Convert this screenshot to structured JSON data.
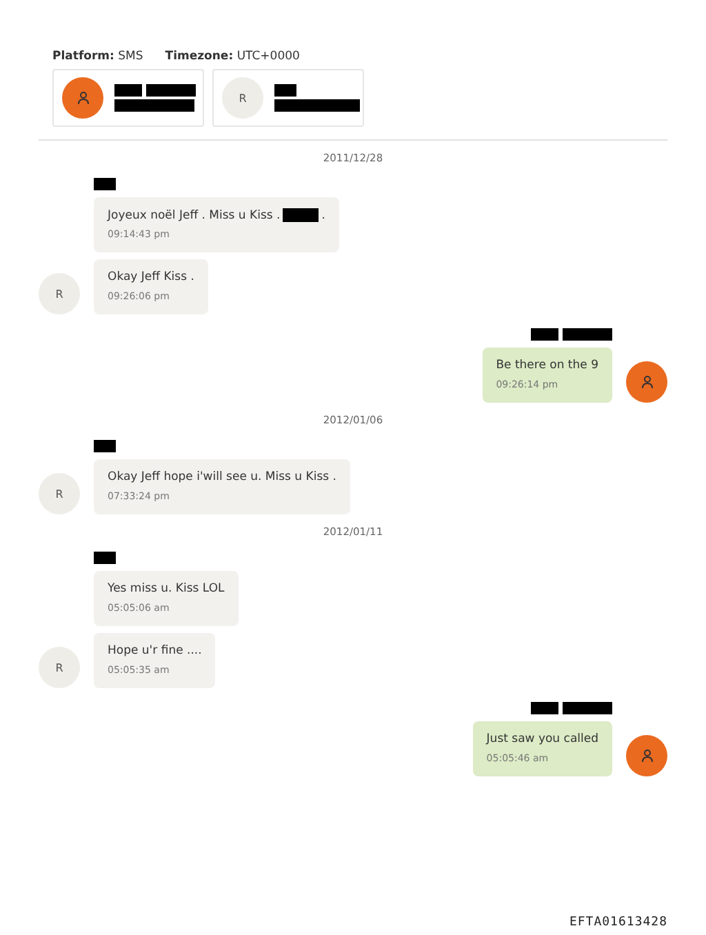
{
  "header": {
    "platform_label": "Platform:",
    "platform": "SMS",
    "timezone_label": "Timezone:",
    "timezone": "UTC+0000"
  },
  "participants": [
    {
      "avatar": {
        "kind": "person"
      }
    },
    {
      "avatar": {
        "kind": "initial",
        "initial": "R"
      }
    }
  ],
  "timeline": [
    {
      "kind": "date",
      "text": "2011/12/28"
    },
    {
      "kind": "group",
      "outgoing": false,
      "avatar": {
        "kind": "initial",
        "initial": "R"
      },
      "messages": [
        {
          "text": "Joyeux noël Jeff . Miss u Kiss .",
          "redacted_tail": true,
          "tail": ".",
          "time": "09:14:43 pm"
        },
        {
          "text": "Okay Jeff Kiss .",
          "time": "09:26:06 pm"
        }
      ]
    },
    {
      "kind": "group",
      "outgoing": true,
      "avatar": {
        "kind": "person"
      },
      "messages": [
        {
          "text": "Be there on the 9",
          "time": "09:26:14 pm"
        }
      ]
    },
    {
      "kind": "date",
      "text": "2012/01/06"
    },
    {
      "kind": "group",
      "outgoing": false,
      "avatar": {
        "kind": "initial",
        "initial": "R"
      },
      "messages": [
        {
          "text": "Okay Jeff hope i'will see u. Miss u Kiss .",
          "time": "07:33:24 pm"
        }
      ]
    },
    {
      "kind": "date",
      "text": "2012/01/11"
    },
    {
      "kind": "group",
      "outgoing": false,
      "avatar": {
        "kind": "initial",
        "initial": "R"
      },
      "messages": [
        {
          "text": "Yes miss u. Kiss LOL",
          "time": "05:05:06 am"
        },
        {
          "text": "Hope u'r fine ....",
          "time": "05:05:35 am"
        }
      ]
    },
    {
      "kind": "group",
      "outgoing": true,
      "avatar": {
        "kind": "person"
      },
      "messages": [
        {
          "text": "Just saw you called",
          "time": "05:05:46 am"
        }
      ]
    }
  ],
  "footer": {
    "stamp": "EFTA01613428"
  }
}
